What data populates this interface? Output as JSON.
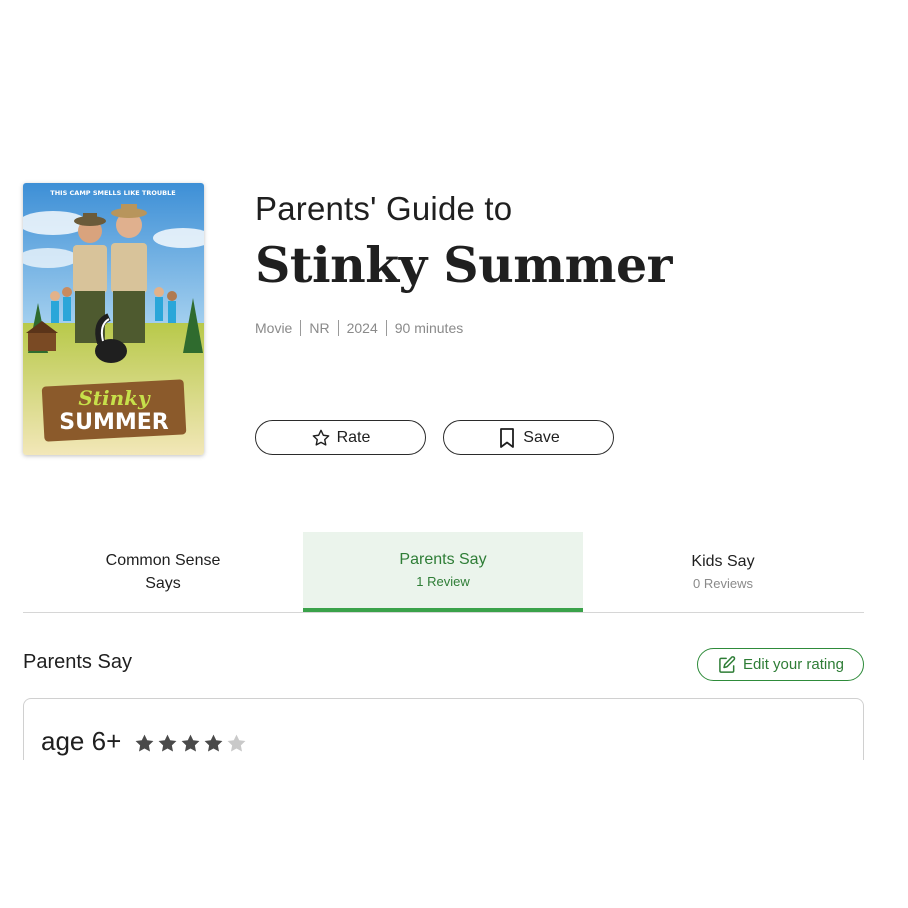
{
  "header": {
    "guide_label": "Parents' Guide to",
    "title": "Stinky Summer",
    "meta": [
      "Movie",
      "NR",
      "2024",
      "90 minutes"
    ]
  },
  "poster": {
    "tagline": "THIS CAMP SMELLS LIKE TROUBLE",
    "logo_line1": "Stinky",
    "logo_line2": "SUMMER"
  },
  "actions": {
    "rate_label": "Rate",
    "save_label": "Save"
  },
  "tabs": [
    {
      "label": "Common Sense Says",
      "sub": ""
    },
    {
      "label": "Parents Say",
      "sub": "1 Review"
    },
    {
      "label": "Kids Say",
      "sub": "0 Reviews"
    }
  ],
  "active_tab": "Parents Say",
  "section": {
    "title": "Parents Say",
    "edit_label": "Edit your rating"
  },
  "review": {
    "age": "age 6+",
    "stars_filled": 4,
    "stars_total": 5
  },
  "colors": {
    "accent": "#2e7d36",
    "tab_active_bg": "#ebf4ec",
    "tab_underline": "#3aa24a",
    "star_filled": "#4a4a4a",
    "star_empty": "#c9c9c9"
  },
  "icons": {
    "rate": "star-outline-icon",
    "save": "bookmark-icon",
    "edit": "edit-pencil-icon"
  }
}
